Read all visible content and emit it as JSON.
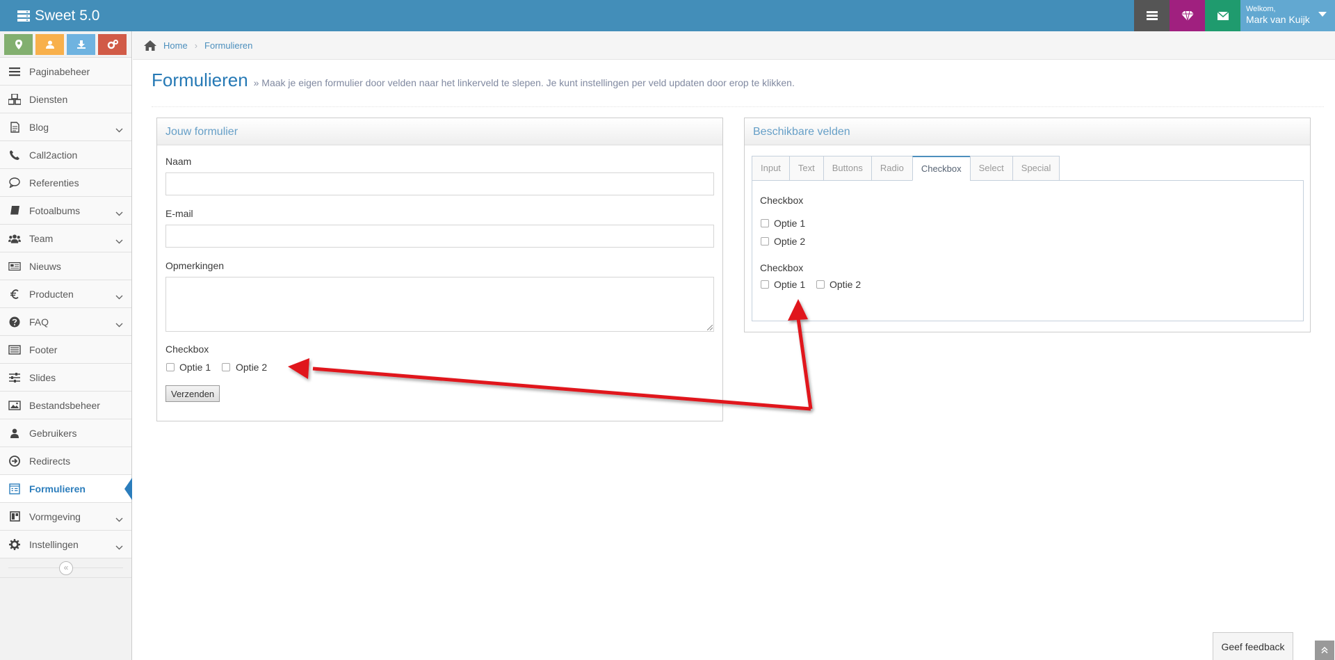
{
  "app": {
    "title": "Sweet 5.0"
  },
  "topbar": {
    "welcome": "Welkom,",
    "user_name": "Mark van Kuijk",
    "colors": {
      "bar": "#438eb9",
      "grey": "#555555",
      "purple": "#a0207f",
      "green": "#1f9b6e",
      "user": "#62a8d1"
    },
    "buttons": [
      "tasks-icon",
      "diamond-icon",
      "envelope-icon"
    ]
  },
  "shortcuts": [
    "map-marker-icon",
    "user-icon",
    "download-icon",
    "cogs-icon"
  ],
  "sidebar": {
    "items": [
      {
        "label": "Paginabeheer",
        "icon": "bars-icon",
        "submenu": false
      },
      {
        "label": "Diensten",
        "icon": "cubes-icon",
        "submenu": false
      },
      {
        "label": "Blog",
        "icon": "file-icon",
        "submenu": true
      },
      {
        "label": "Call2action",
        "icon": "phone-icon",
        "submenu": false
      },
      {
        "label": "Referenties",
        "icon": "comment-icon",
        "submenu": false
      },
      {
        "label": "Fotoalbums",
        "icon": "book-icon",
        "submenu": true
      },
      {
        "label": "Team",
        "icon": "users-icon",
        "submenu": true
      },
      {
        "label": "Nieuws",
        "icon": "newspaper-icon",
        "submenu": false
      },
      {
        "label": "Producten",
        "icon": "euro-icon",
        "submenu": true
      },
      {
        "label": "FAQ",
        "icon": "question-icon",
        "submenu": true
      },
      {
        "label": "Footer",
        "icon": "list-alt-icon",
        "submenu": false
      },
      {
        "label": "Slides",
        "icon": "sliders-icon",
        "submenu": false
      },
      {
        "label": "Bestandsbeheer",
        "icon": "image-icon",
        "submenu": false
      },
      {
        "label": "Gebruikers",
        "icon": "user-icon",
        "submenu": false
      },
      {
        "label": "Redirects",
        "icon": "arrow-circle-icon",
        "submenu": false
      },
      {
        "label": "Formulieren",
        "icon": "form-icon",
        "submenu": false,
        "active": true
      },
      {
        "label": "Vormgeving",
        "icon": "layout-icon",
        "submenu": true
      },
      {
        "label": "Instellingen",
        "icon": "gear-icon",
        "submenu": true
      }
    ],
    "collapse_glyph": "«"
  },
  "breadcrumb": {
    "home": "Home",
    "current": "Formulieren"
  },
  "page": {
    "title": "Formulieren",
    "subtitle": "» Maak je eigen formulier door velden naar het linkerveld te slepen. Je kunt instellingen per veld updaten door erop te klikken."
  },
  "form_panel": {
    "title": "Jouw formulier",
    "fields": {
      "name": "Naam",
      "email": "E-mail",
      "remarks": "Opmerkingen"
    },
    "checkbox_label": "Checkbox",
    "option1": "Optie 1",
    "option2": "Optie 2",
    "submit": "Verzenden"
  },
  "fields_panel": {
    "title": "Beschikbare velden",
    "tabs": [
      "Input",
      "Text",
      "Buttons",
      "Radio",
      "Checkbox",
      "Select",
      "Special"
    ],
    "active_tab": "Checkbox",
    "group1_label": "Checkbox",
    "group2_label": "Checkbox",
    "option1": "Optie 1",
    "option2": "Optie 2"
  },
  "footer": {
    "feedback": "Geef feedback"
  },
  "annotation": {
    "arrow_color": "#e0141c"
  }
}
